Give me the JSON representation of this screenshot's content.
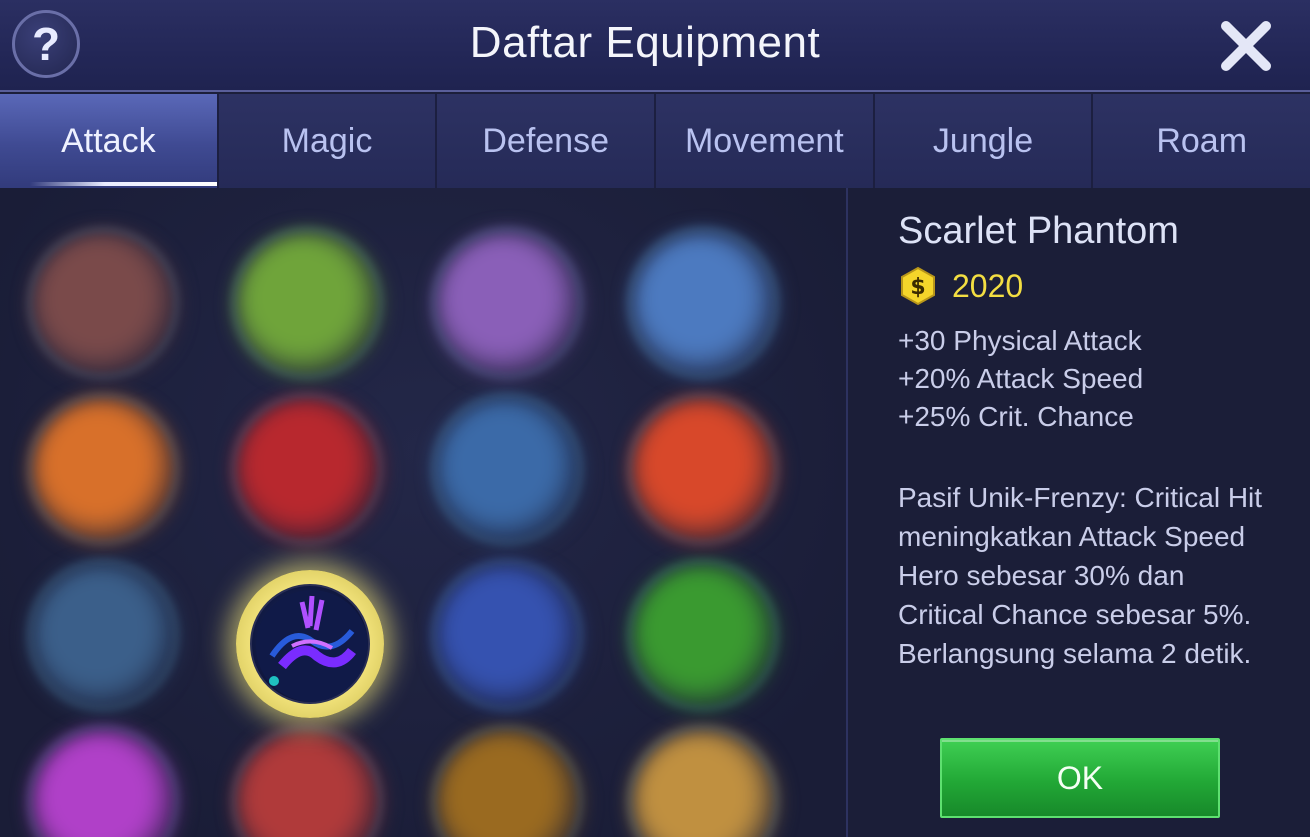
{
  "header": {
    "title": "Daftar Equipment",
    "help_icon": "question-mark-icon",
    "help_symbol": "?",
    "close_icon": "close-x-icon"
  },
  "tabs": [
    {
      "label": "Attack",
      "active": true
    },
    {
      "label": "Magic",
      "active": false
    },
    {
      "label": "Defense",
      "active": false
    },
    {
      "label": "Movement",
      "active": false
    },
    {
      "label": "Jungle",
      "active": false
    },
    {
      "label": "Roam",
      "active": false
    }
  ],
  "item_grid": {
    "selected_index": 9,
    "slot_colors": [
      "#7a4a4a",
      "#6fa43a",
      "#8a5fb8",
      "#4c7ac0",
      "#d8702a",
      "#b8282e",
      "#3b6aa8",
      "#d8482a",
      "#3b5f8a",
      "#5a30a0",
      "#3552b0",
      "#3a9a30",
      "#b040c8",
      "#b03a3a",
      "#9a6a20",
      "#c09040"
    ]
  },
  "detail": {
    "name": "Scarlet Phantom",
    "price": "2020",
    "currency_icon": "gold-coin-icon",
    "currency_symbol": "$",
    "stats": [
      "+30 Physical Attack",
      "+20% Attack Speed",
      "+25% Crit. Chance"
    ],
    "passive": "Pasif Unik-Frenzy: Critical Hit meningkatkan Attack Speed Hero sebesar 30% dan Critical Chance sebesar 5%. Berlangsung selama 2 detik.",
    "ok_label": "OK"
  },
  "colors": {
    "accent_gold": "#f3de42",
    "ok_green": "#22a836",
    "active_tab": "#4a57a3"
  }
}
